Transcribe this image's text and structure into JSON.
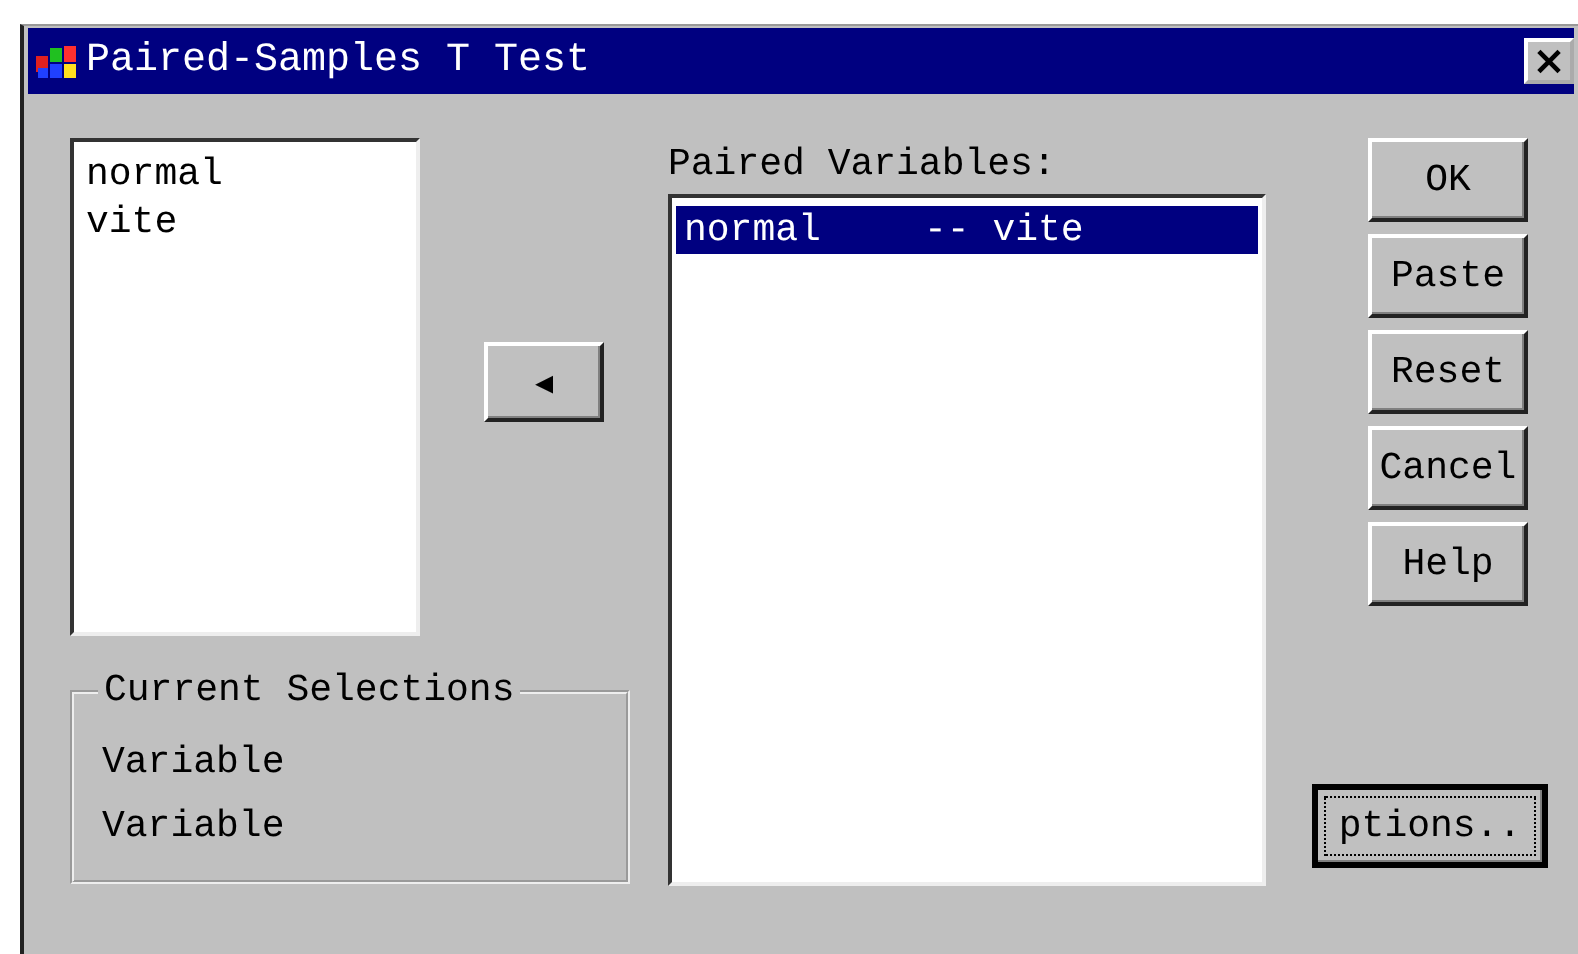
{
  "window": {
    "title": "Paired-Samples T Test",
    "close": "×"
  },
  "variables": [
    {
      "label": "normal",
      "selected": false
    },
    {
      "label": "vite",
      "selected": false
    }
  ],
  "move_button": {
    "label": "◂"
  },
  "current_selections": {
    "title": "Current Selections",
    "rows": [
      "Variable",
      "Variable"
    ]
  },
  "paired_variables": {
    "label": "Paired Variables:",
    "items": [
      {
        "first": "normal",
        "second": "-- vite",
        "selected": true
      }
    ]
  },
  "buttons": [
    {
      "label": "OK",
      "focused": false
    },
    {
      "label": "Paste",
      "focused": false
    },
    {
      "label": "Reset",
      "focused": false
    },
    {
      "label": "Cancel",
      "focused": false
    },
    {
      "label": "Help",
      "focused": false
    }
  ],
  "options_button": {
    "label": "ptions..",
    "focused": true
  }
}
